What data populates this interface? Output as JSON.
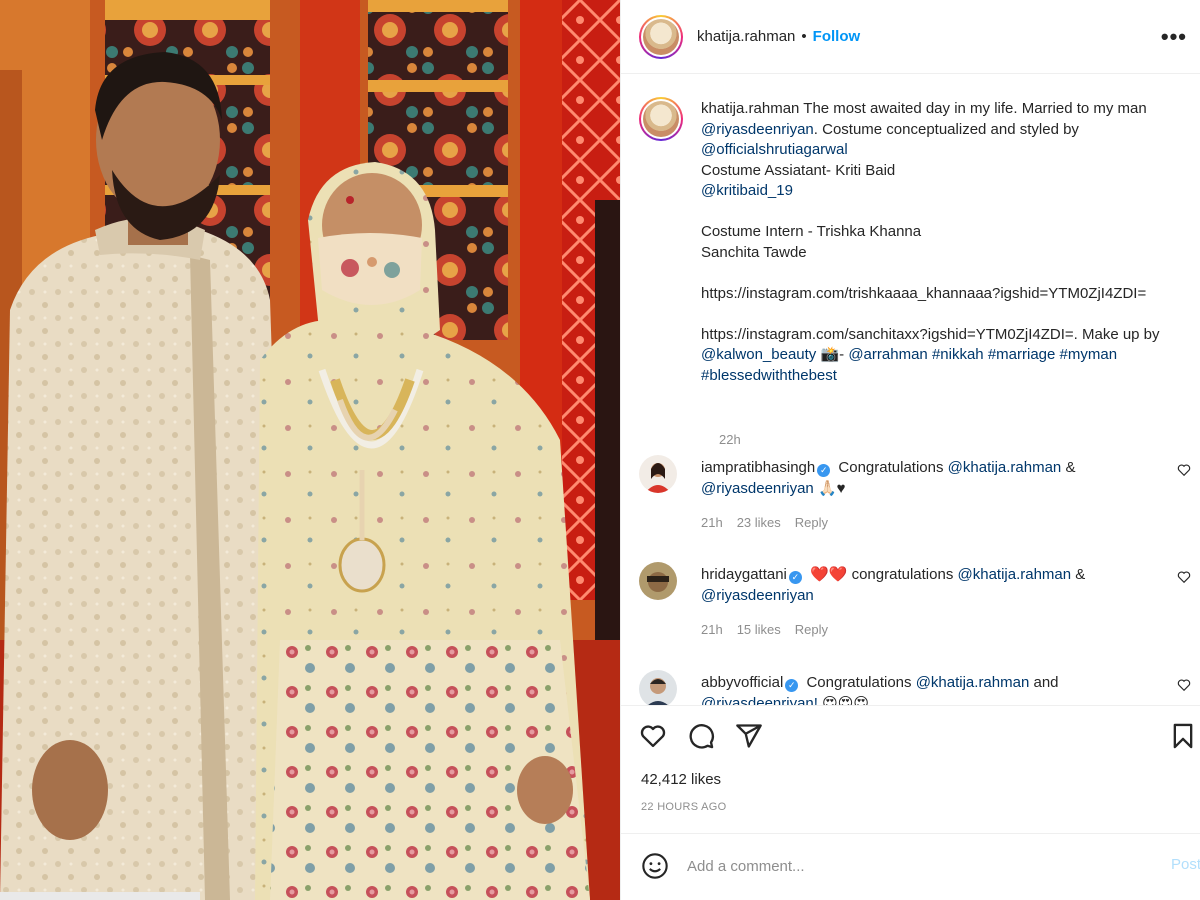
{
  "post": {
    "username": "khatija.rahman",
    "dot": "•",
    "follow_label": "Follow",
    "more_label": "•••"
  },
  "caption": {
    "username": "khatija.rahman",
    "segments": [
      {
        "type": "text",
        "text": " The most awaited day in my life. Married to my man "
      },
      {
        "type": "mention",
        "text": "@riyasdeenriyan"
      },
      {
        "type": "text",
        "text": ". Costume conceptualized and styled by "
      },
      {
        "type": "mention",
        "text": "@officialshrutiagarwal"
      },
      {
        "type": "text",
        "text": "\nCostume Assiatant- Kriti Baid\n"
      },
      {
        "type": "mention",
        "text": "@kritibaid_19"
      },
      {
        "type": "text",
        "text": "\n\nCostume Intern - Trishka Khanna\nSanchita Tawde\n\nhttps://instagram.com/trishkaaaa_khannaaa?igshid=YTM0ZjI4ZDI=\n\nhttps://instagram.com/sanchitaxx?igshid=YTM0ZjI4ZDI=. Make up by "
      },
      {
        "type": "mention",
        "text": "@kalwon_beauty"
      },
      {
        "type": "text",
        "text": " 📸- "
      },
      {
        "type": "mention",
        "text": "@arrahman"
      },
      {
        "type": "text",
        "text": " "
      },
      {
        "type": "tag",
        "text": "#nikkah"
      },
      {
        "type": "text",
        "text": " "
      },
      {
        "type": "tag",
        "text": "#marriage"
      },
      {
        "type": "text",
        "text": " "
      },
      {
        "type": "tag",
        "text": "#myman"
      },
      {
        "type": "text",
        "text": "\n"
      },
      {
        "type": "tag",
        "text": "#blessedwiththebest"
      }
    ],
    "time": "22h"
  },
  "comments": [
    {
      "username": "iampratibhasingh",
      "verified_mark": "✓",
      "text_before": " Congratulations ",
      "mention1": "@khatija.rahman",
      "text_mid": " & ",
      "mention2": "@riyasdeenriyan",
      "text_after": " 🙏🏻♥",
      "time": "21h",
      "likes": "23 likes",
      "reply": "Reply"
    },
    {
      "username": "hridaygattani",
      "verified_mark": "✓",
      "text_before": " ❤️❤️ congratulations ",
      "mention1": "@khatija.rahman",
      "text_mid": " & ",
      "mention2": "@riyasdeenriyan",
      "text_after": "",
      "time": "21h",
      "likes": "15 likes",
      "reply": "Reply"
    },
    {
      "username": "abbyvofficial",
      "verified_mark": "✓",
      "text_before": " Congratulations ",
      "mention1": "@khatija.rahman",
      "text_mid": " and ",
      "mention2": "@riyasdeenriyan!",
      "text_after": " 😍😍😍",
      "time": "",
      "likes": "",
      "reply": ""
    }
  ],
  "actions": {
    "likes": "42,412 likes",
    "timeago": "22 HOURS AGO"
  },
  "add_comment": {
    "placeholder": "Add a comment...",
    "post_label": "Post"
  },
  "icons": {
    "emoji": "emoji-icon",
    "heart": "heart-icon",
    "comment": "comment-icon",
    "share": "share-icon",
    "save": "bookmark-icon",
    "more": "more-icon"
  },
  "colors": {
    "link": "#0095f6",
    "mention": "#00376b",
    "muted": "#8e8e8e",
    "text": "#262626",
    "post_disabled": "#b2dffc",
    "verified": "#3897f0"
  }
}
